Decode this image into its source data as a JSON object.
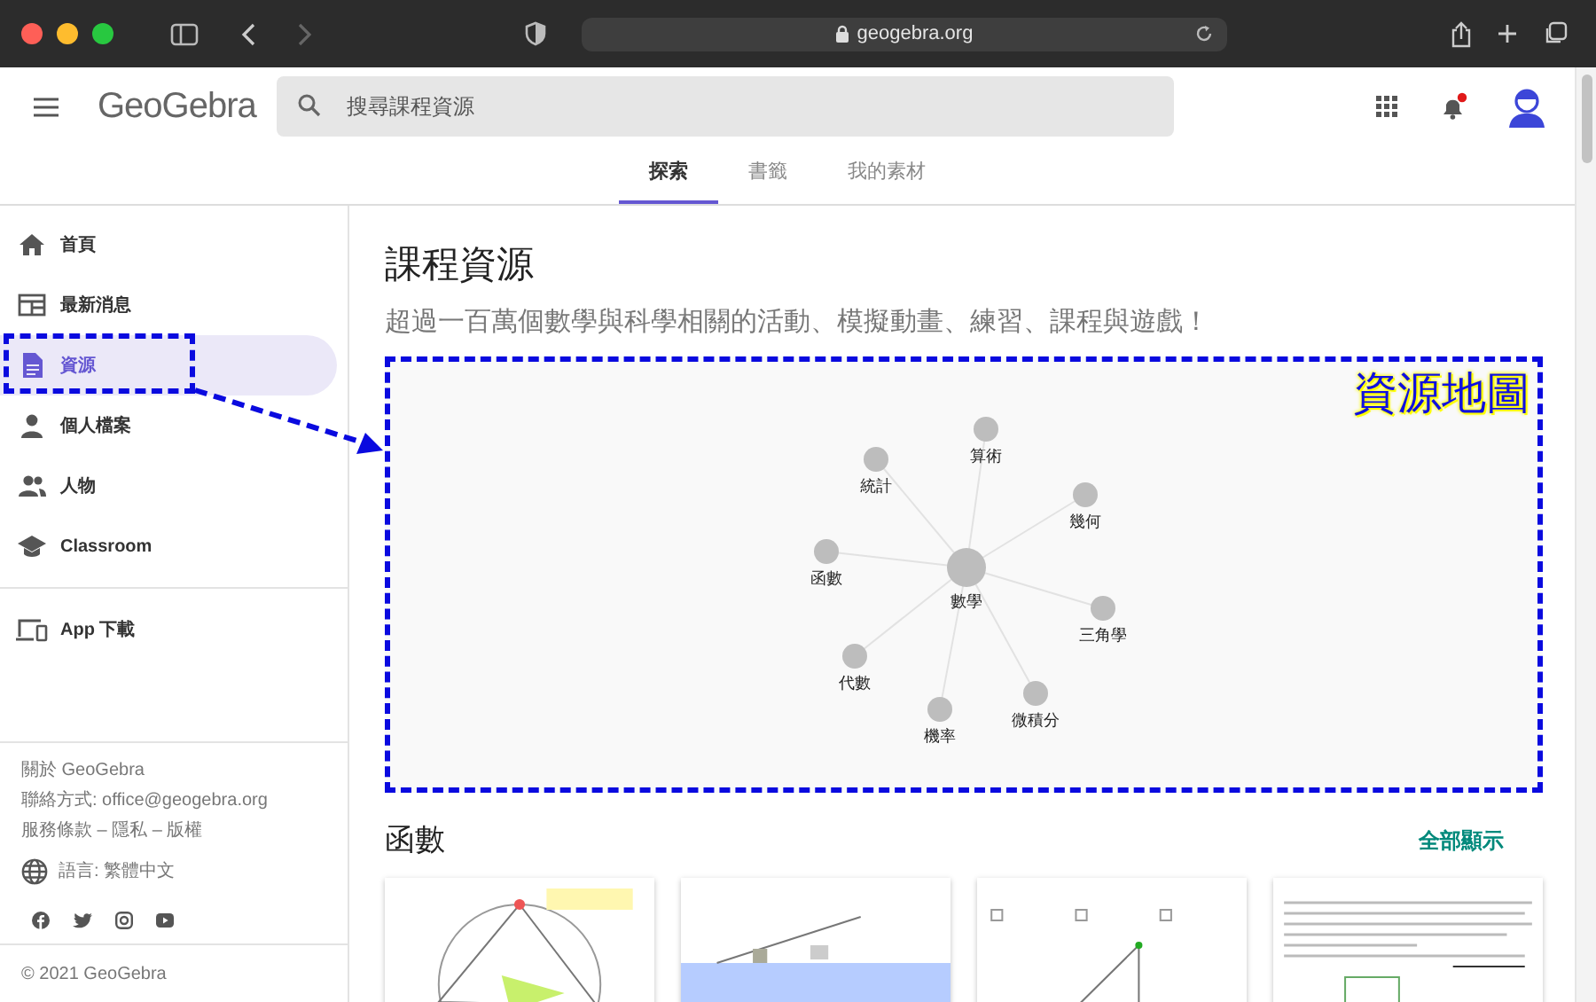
{
  "browser": {
    "url": "geogebra.org"
  },
  "header": {
    "logo": "GeoGebra",
    "search": {
      "placeholder": "搜尋課程資源"
    }
  },
  "tabs": [
    {
      "label": "探索",
      "selected": true
    },
    {
      "label": "書籤",
      "selected": false
    },
    {
      "label": "我的素材",
      "selected": false
    }
  ],
  "sidebar": {
    "items": [
      {
        "label": "首頁",
        "kind": "home",
        "selected": false
      },
      {
        "label": "最新消息",
        "kind": "news",
        "selected": false
      },
      {
        "label": "資源",
        "kind": "resources",
        "selected": true
      },
      {
        "label": "個人檔案",
        "kind": "profile",
        "selected": false
      },
      {
        "label": "人物",
        "kind": "people",
        "selected": false
      },
      {
        "label": "Classroom",
        "kind": "classroom",
        "selected": false
      }
    ],
    "download": "App 下載",
    "footer": {
      "about": "關於 GeoGebra",
      "contact": "聯絡方式: office@geogebra.org",
      "legal": "服務條款 – 隱私 – 版權",
      "language": "語言: 繁體中文",
      "copyright": "© 2021 GeoGebra"
    }
  },
  "main": {
    "title": "課程資源",
    "subtitle": "超過一百萬個數學與科學相關的活動、模擬動畫、練習、課程與遊戲！",
    "resource_map": {
      "center": "數學",
      "topics": [
        "算術",
        "統計",
        "幾何",
        "函數",
        "三角學",
        "代數",
        "微積分",
        "機率"
      ]
    },
    "section": {
      "title": "函數",
      "show_all": "全部顯示",
      "cards": [
        {
          "kind": "circle"
        },
        {
          "kind": "ramp"
        },
        {
          "kind": "ratios"
        },
        {
          "kind": "text"
        }
      ]
    }
  },
  "annotation": {
    "label": "資源地圖"
  }
}
